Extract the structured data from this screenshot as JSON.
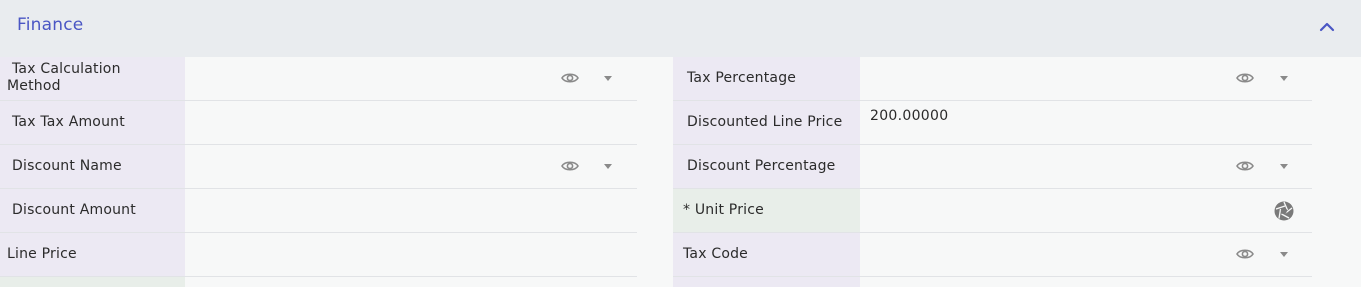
{
  "section": {
    "title": "Finance",
    "collapse_icon": "chevron-up-icon",
    "accent_color": "#4a56c4"
  },
  "left_fields": [
    {
      "label": "Tax Calculation Method",
      "label_line1": "Tax Calculation",
      "label_line2": "Method",
      "value": "",
      "control": "dropdown"
    },
    {
      "label": "Tax Tax Amount",
      "value": "",
      "control": "text"
    },
    {
      "label": "Discount Name",
      "value": "",
      "control": "dropdown"
    },
    {
      "label": "Discount Amount",
      "value": "",
      "control": "text"
    },
    {
      "label": "Line Price",
      "value": "",
      "control": "text"
    }
  ],
  "right_fields": [
    {
      "label": "Tax Percentage",
      "value": "",
      "control": "dropdown"
    },
    {
      "label": "Discounted Line Price",
      "value": "200.00000",
      "control": "text"
    },
    {
      "label": "Discount Percentage",
      "value": "",
      "control": "dropdown"
    },
    {
      "label": "* Unit Price",
      "value": "",
      "control": "lens",
      "required": true
    },
    {
      "label": "Tax Code",
      "value": "",
      "control": "dropdown"
    }
  ],
  "icons": {
    "view": "eye-icon",
    "dropdown": "caret-down-icon",
    "lookup": "aperture-icon"
  }
}
